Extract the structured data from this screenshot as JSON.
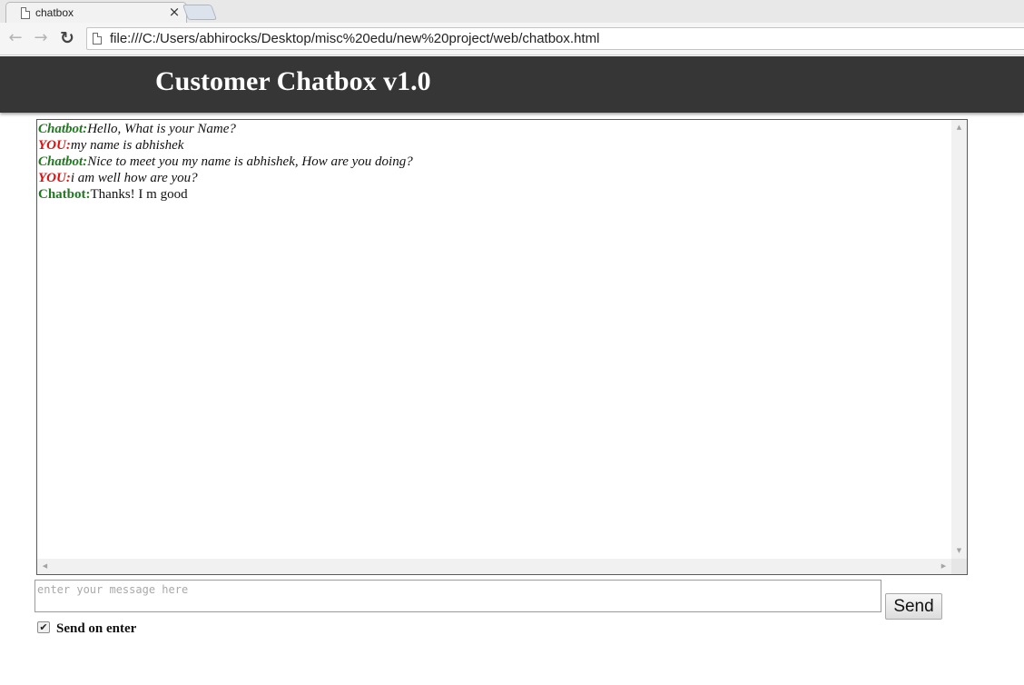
{
  "browser": {
    "tab_title": "chatbox",
    "tab_close": "×",
    "url": "file:///C:/Users/abhirocks/Desktop/misc%20edu/new%20project/web/chatbox.html",
    "icons": {
      "back": "←",
      "forward": "→",
      "reload": "↻",
      "page": "document-icon"
    }
  },
  "header": {
    "title": "Customer Chatbox v1.0"
  },
  "colors": {
    "chatbot": "#1f7a1f",
    "user": "#e01010",
    "header_bg": "#363636"
  },
  "chat": {
    "messages": [
      {
        "speaker": "Chatbot:",
        "text": "Hello, What is your Name?",
        "role": "chatbot",
        "italic": true
      },
      {
        "speaker": "YOU:",
        "text": "my name is abhishek",
        "role": "user",
        "italic": true
      },
      {
        "speaker": "Chatbot:",
        "text": "Nice to meet you my name is abhishek, How are you doing?",
        "role": "chatbot",
        "italic": true
      },
      {
        "speaker": "YOU:",
        "text": "i am well how are you?",
        "role": "user",
        "italic": true
      },
      {
        "speaker": "Chatbot:",
        "text": "Thanks! I m good",
        "role": "chatbot",
        "italic": false
      }
    ]
  },
  "composer": {
    "placeholder": "enter your message here",
    "value": "",
    "send_label": "Send",
    "send_on_enter_label": "Send on enter",
    "send_on_enter_checked": true
  }
}
